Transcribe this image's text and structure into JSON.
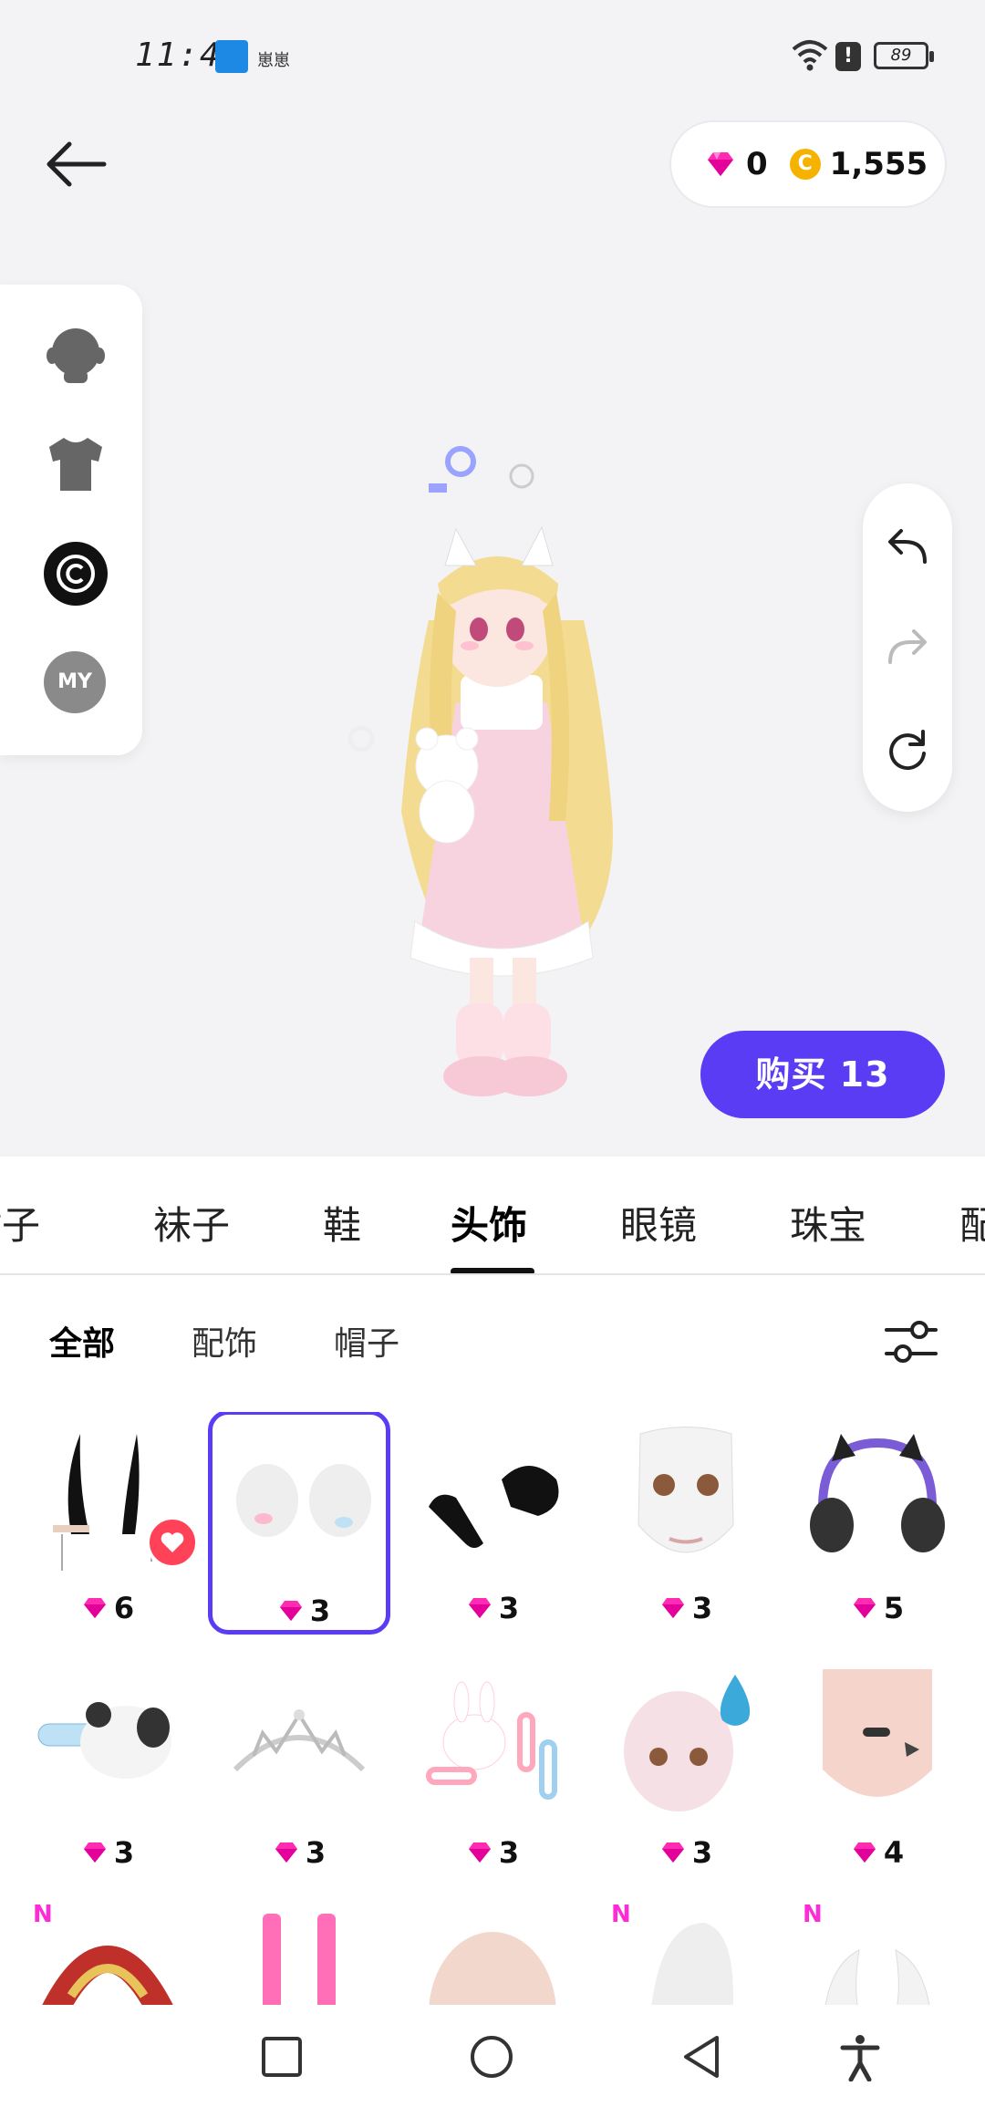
{
  "status_bar": {
    "time": "11:40",
    "app_tag": "崽崽",
    "battery": "89"
  },
  "header": {
    "gems": "0",
    "coins": "1,555"
  },
  "left_rail": {
    "my_label": "MY"
  },
  "buy_button": "购买 13",
  "category_tabs": [
    "裙子",
    "袜子",
    "鞋",
    "头饰",
    "眼镜",
    "珠宝",
    "配"
  ],
  "sub_tabs": [
    "全部",
    "配饰",
    "帽子"
  ],
  "items": [
    {
      "price": "6",
      "favorited": true
    },
    {
      "price": "3",
      "selected": true
    },
    {
      "price": "3"
    },
    {
      "price": "3"
    },
    {
      "price": "5"
    },
    {
      "price": "3"
    },
    {
      "price": "3"
    },
    {
      "price": "3"
    },
    {
      "price": "3"
    },
    {
      "price": "4"
    },
    {
      "badge": "N"
    },
    {},
    {},
    {
      "badge": "N"
    },
    {
      "badge": "N"
    }
  ],
  "colors": {
    "accent": "#5b3cf5",
    "gem": "#ff2bb0",
    "coin": "#f5b300",
    "heart": "#ff4257"
  }
}
